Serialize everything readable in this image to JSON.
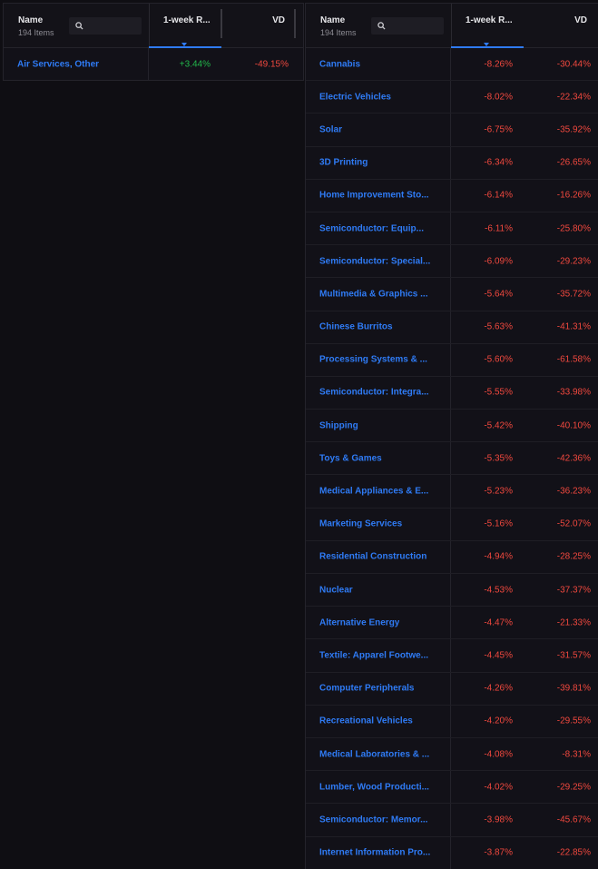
{
  "colors": {
    "background": "#0f0e13",
    "link": "#2f7bf5",
    "negative": "#f0483e",
    "positive": "#22b84b",
    "sort_accent": "#2f7bf5"
  },
  "left_table": {
    "header": {
      "name_label": "Name",
      "count_label": "194 Items",
      "search_icon": "search-icon",
      "week_label": "1-week R...",
      "vd_label": "VD"
    },
    "rows": [
      {
        "name": "Air Services, Other",
        "week": "+3.44%",
        "week_sign": "pos",
        "vd": "-49.15%",
        "vd_sign": "neg"
      }
    ]
  },
  "right_table": {
    "header": {
      "name_label": "Name",
      "count_label": "194 Items",
      "search_icon": "search-icon",
      "week_label": "1-week R...",
      "vd_label": "VD"
    },
    "rows": [
      {
        "name": "Cannabis",
        "week": "-8.26%",
        "vd": "-30.44%"
      },
      {
        "name": "Electric Vehicles",
        "week": "-8.02%",
        "vd": "-22.34%"
      },
      {
        "name": "Solar",
        "week": "-6.75%",
        "vd": "-35.92%"
      },
      {
        "name": "3D Printing",
        "week": "-6.34%",
        "vd": "-26.65%"
      },
      {
        "name": "Home Improvement Sto...",
        "week": "-6.14%",
        "vd": "-16.26%"
      },
      {
        "name": "Semiconductor: Equip...",
        "week": "-6.11%",
        "vd": "-25.80%"
      },
      {
        "name": "Semiconductor: Special...",
        "week": "-6.09%",
        "vd": "-29.23%"
      },
      {
        "name": "Multimedia & Graphics ...",
        "week": "-5.64%",
        "vd": "-35.72%"
      },
      {
        "name": "Chinese Burritos",
        "week": "-5.63%",
        "vd": "-41.31%"
      },
      {
        "name": "Processing Systems & ...",
        "week": "-5.60%",
        "vd": "-61.58%"
      },
      {
        "name": "Semiconductor: Integra...",
        "week": "-5.55%",
        "vd": "-33.98%"
      },
      {
        "name": "Shipping",
        "week": "-5.42%",
        "vd": "-40.10%"
      },
      {
        "name": "Toys & Games",
        "week": "-5.35%",
        "vd": "-42.36%"
      },
      {
        "name": "Medical Appliances & E...",
        "week": "-5.23%",
        "vd": "-36.23%"
      },
      {
        "name": "Marketing Services",
        "week": "-5.16%",
        "vd": "-52.07%"
      },
      {
        "name": "Residential Construction",
        "week": "-4.94%",
        "vd": "-28.25%"
      },
      {
        "name": "Nuclear",
        "week": "-4.53%",
        "vd": "-37.37%"
      },
      {
        "name": "Alternative Energy",
        "week": "-4.47%",
        "vd": "-21.33%"
      },
      {
        "name": "Textile: Apparel Footwe...",
        "week": "-4.45%",
        "vd": "-31.57%"
      },
      {
        "name": "Computer Peripherals",
        "week": "-4.26%",
        "vd": "-39.81%"
      },
      {
        "name": "Recreational Vehicles",
        "week": "-4.20%",
        "vd": "-29.55%"
      },
      {
        "name": "Medical Laboratories & ...",
        "week": "-4.08%",
        "vd": "-8.31%"
      },
      {
        "name": "Lumber, Wood Producti...",
        "week": "-4.02%",
        "vd": "-29.25%"
      },
      {
        "name": "Semiconductor: Memor...",
        "week": "-3.98%",
        "vd": "-45.67%"
      },
      {
        "name": "Internet Information Pro...",
        "week": "-3.87%",
        "vd": "-22.85%"
      }
    ]
  }
}
